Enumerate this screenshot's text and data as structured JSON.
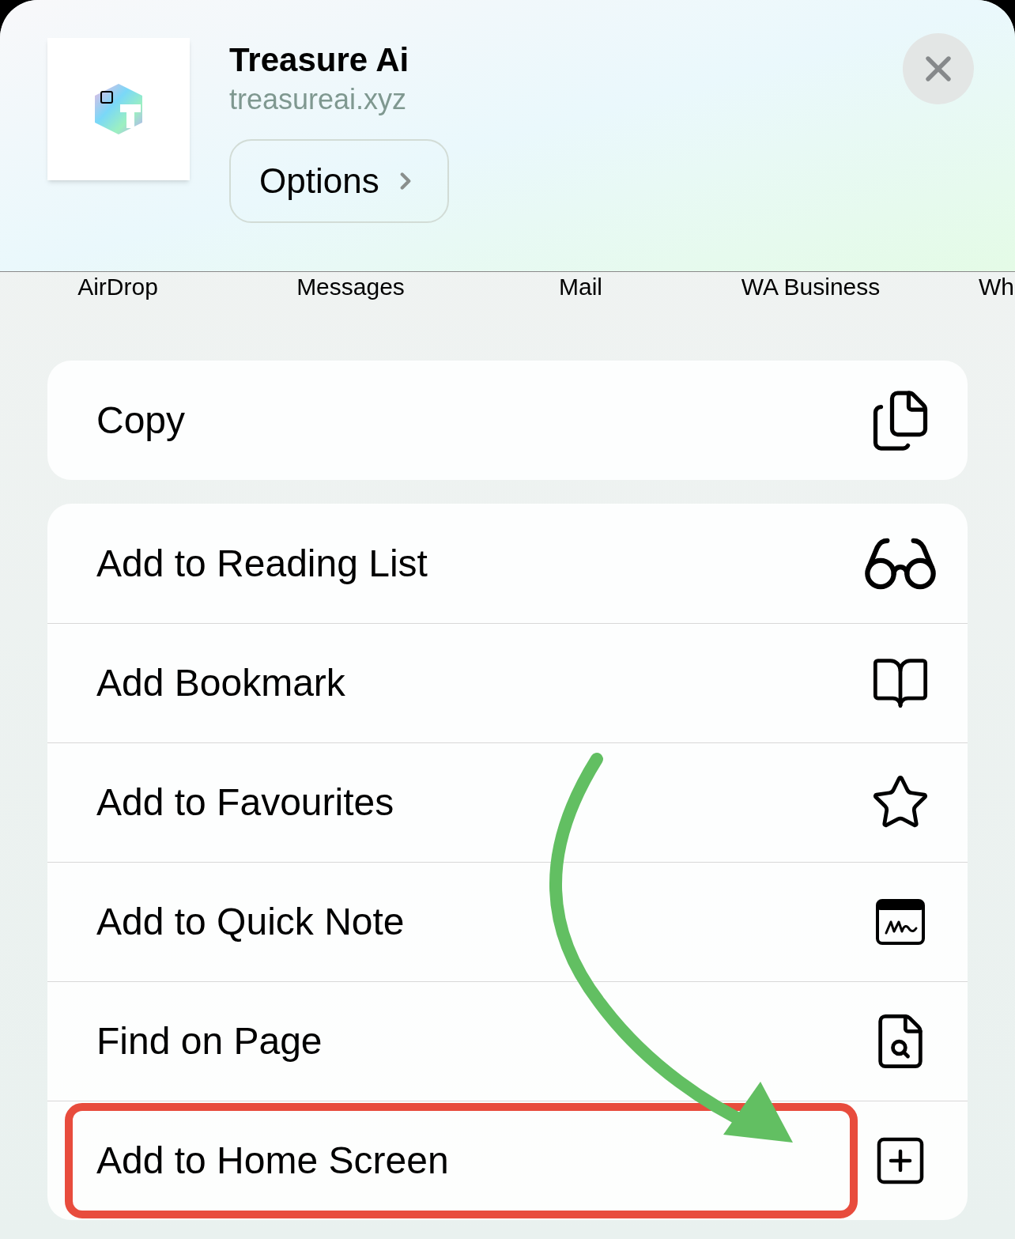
{
  "header": {
    "title": "Treasure Ai",
    "subtitle": "treasureai.xyz",
    "options_button": "Options"
  },
  "share_targets": [
    "AirDrop",
    "Messages",
    "Mail",
    "WA Business",
    "Wh"
  ],
  "action_groups": [
    [
      {
        "label": "Copy",
        "kind": "copy",
        "highlighted": false
      }
    ],
    [
      {
        "label": "Add to Reading List",
        "kind": "reading",
        "highlighted": false
      },
      {
        "label": "Add Bookmark",
        "kind": "bookmark",
        "highlighted": false
      },
      {
        "label": "Add to Favourites",
        "kind": "favourite",
        "highlighted": false
      },
      {
        "label": "Add to Quick Note",
        "kind": "note",
        "highlighted": false
      },
      {
        "label": "Find on Page",
        "kind": "find",
        "highlighted": false
      },
      {
        "label": "Add to Home Screen",
        "kind": "home",
        "highlighted": true
      }
    ]
  ]
}
